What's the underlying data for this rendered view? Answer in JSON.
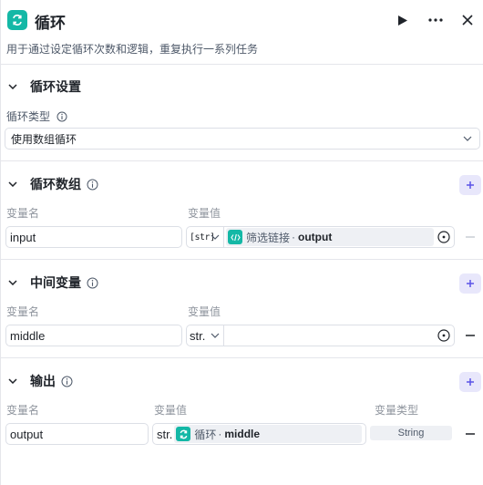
{
  "header": {
    "title": "循环",
    "description": "用于通过设定循环次数和逻辑，重复执行一系列任务",
    "icon": "loop-icon",
    "actions": [
      "run-icon",
      "more-icon",
      "close-icon"
    ]
  },
  "loop_settings": {
    "section_title": "循环设置",
    "type_label": "循环类型",
    "type_value": "使用数组循环"
  },
  "loop_array": {
    "section_title": "循环数组",
    "col_name": "变量名",
    "col_value": "变量值",
    "rows": [
      {
        "name": "input",
        "type": "[str]",
        "ref_node": "筛选链接",
        "ref_sep": "·",
        "ref_var": "output"
      }
    ]
  },
  "intermediate": {
    "section_title": "中间变量",
    "col_name": "变量名",
    "col_value": "变量值",
    "rows": [
      {
        "name": "middle",
        "type": "str.",
        "value": ""
      }
    ]
  },
  "output": {
    "section_title": "输出",
    "col_name": "变量名",
    "col_value": "变量值",
    "col_type": "变量类型",
    "rows": [
      {
        "name": "output",
        "type": "str.",
        "ref_node": "循环",
        "ref_sep": "·",
        "ref_var": "middle",
        "var_type": "String"
      }
    ]
  },
  "colors": {
    "accent": "#14b8a6",
    "add_button_bg": "#e8e7fb",
    "add_button_fg": "#5b54e8"
  }
}
